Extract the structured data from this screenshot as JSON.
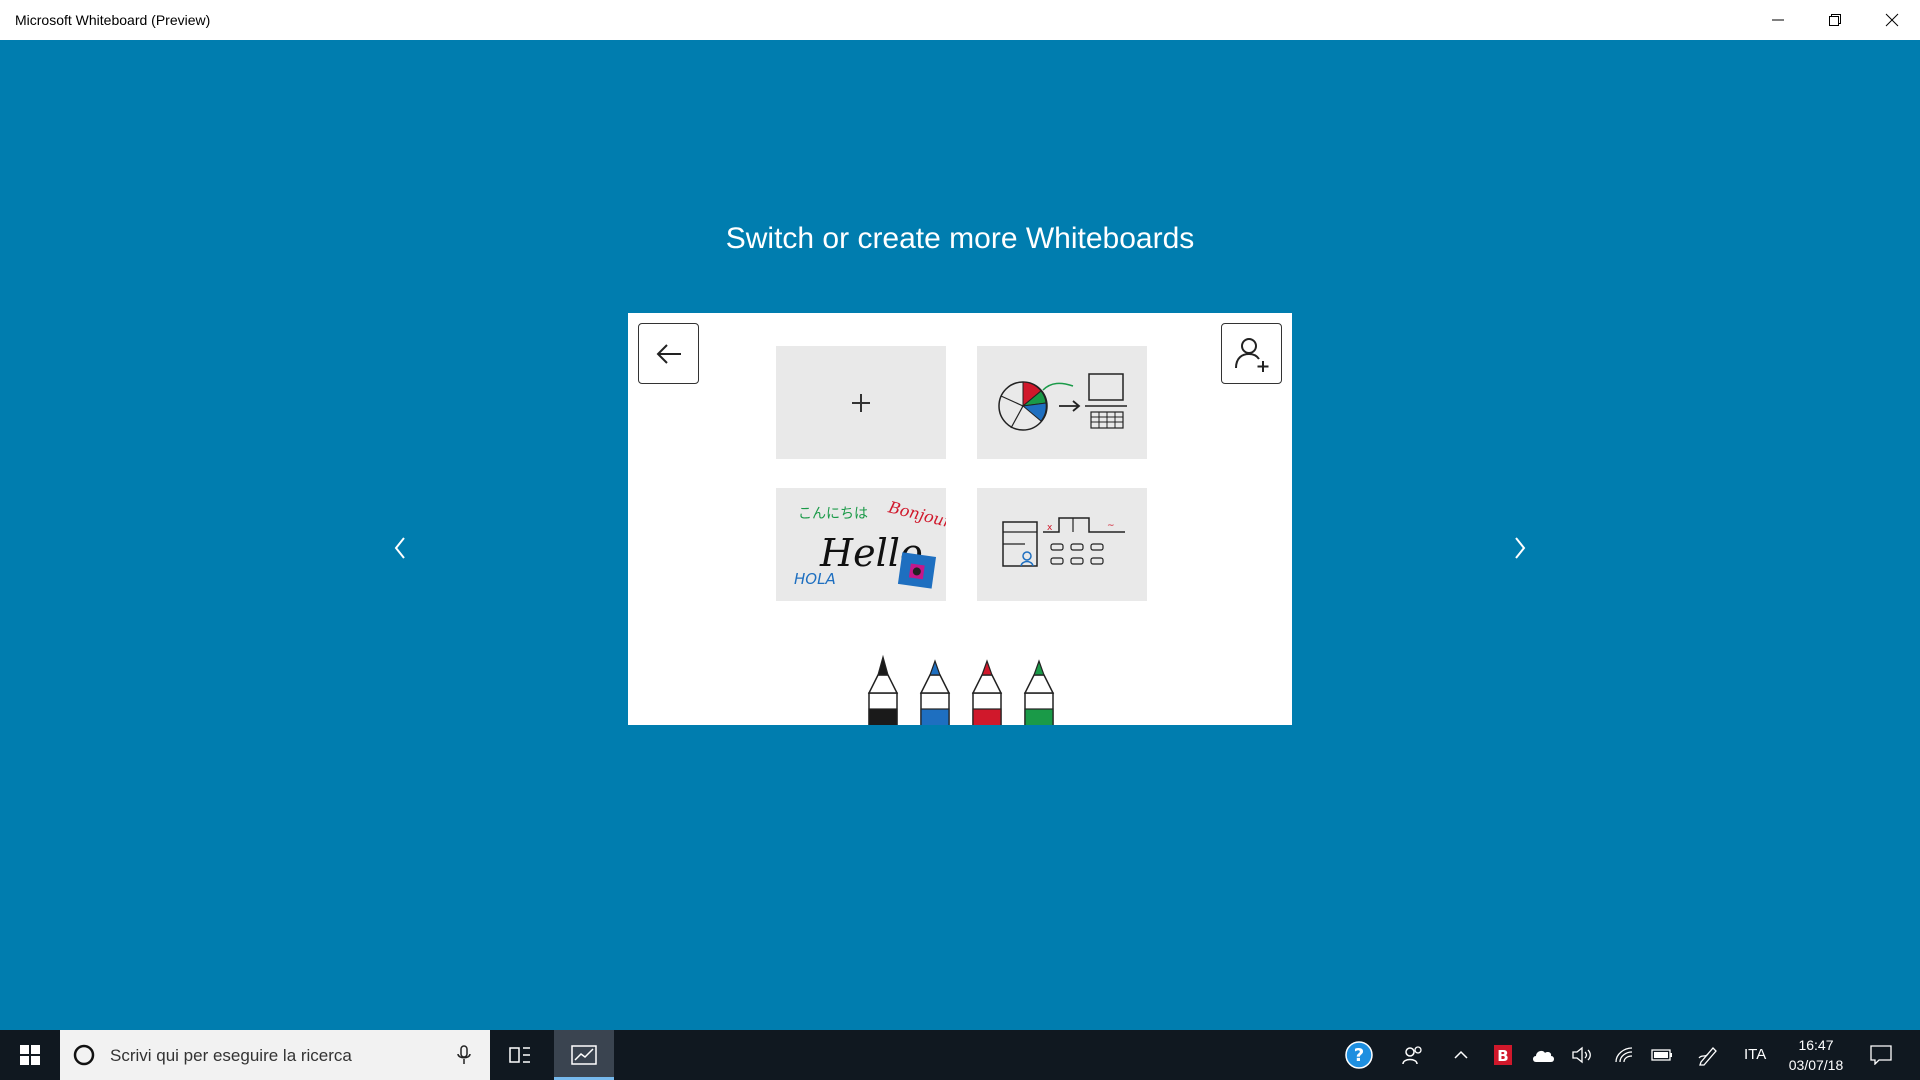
{
  "window": {
    "title": "Microsoft Whiteboard (Preview)",
    "controls": [
      "minimize-icon",
      "restore-icon",
      "close-icon"
    ]
  },
  "main": {
    "heading": "Switch or create more Whiteboards",
    "nav": {
      "prev_icon": "chevron-left-icon",
      "next_icon": "chevron-right-icon"
    },
    "illustration": {
      "back_icon": "arrow-left-icon",
      "invite_icon": "add-person-icon",
      "new_tile_icon": "plus-icon",
      "hello_tile": {
        "greeting_jp": "こんにちは",
        "greeting_fr": "Bonjour",
        "greeting_en": "Hello",
        "greeting_es": "HOLA"
      },
      "marker_colors": [
        "#1a1a1a",
        "#1e6fc0",
        "#d0182b",
        "#1a9a48"
      ]
    }
  },
  "taskbar": {
    "start_icon": "windows-start-icon",
    "search_placeholder": "Scrivi qui per eseguire la ricerca",
    "tray": {
      "language": "ITA",
      "time": "16:47",
      "date": "03/07/18"
    }
  },
  "colors": {
    "background": "#007DAF",
    "taskbar": "#101820"
  }
}
